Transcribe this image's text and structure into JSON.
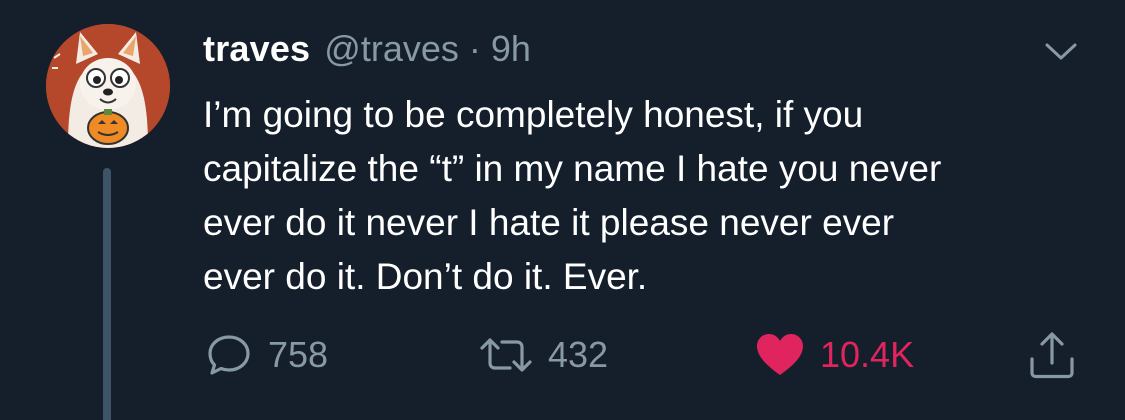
{
  "tweet": {
    "display_name": "traves",
    "handle": "@traves",
    "separator": "·",
    "time": "9h",
    "text_lines": [
      "I’m going to be completely honest, if you",
      "capitalize the “t” in my name I hate you never",
      "ever do it never I hate it please never ever",
      "ever do it. Don’t do it. Ever."
    ]
  },
  "actions": {
    "reply_count": "758",
    "retweet_count": "432",
    "like_count": "10.4K"
  },
  "icons": {
    "avatar": "dog-ghost-pumpkin-avatar",
    "menu": "chevron-down-icon",
    "reply": "reply-icon",
    "retweet": "retweet-icon",
    "like": "heart-icon",
    "share": "share-icon"
  },
  "colors": {
    "background": "#151f2b",
    "text": "#ffffff",
    "muted": "#8899a6",
    "like": "#e0245e",
    "thread_line": "#3d5466"
  }
}
